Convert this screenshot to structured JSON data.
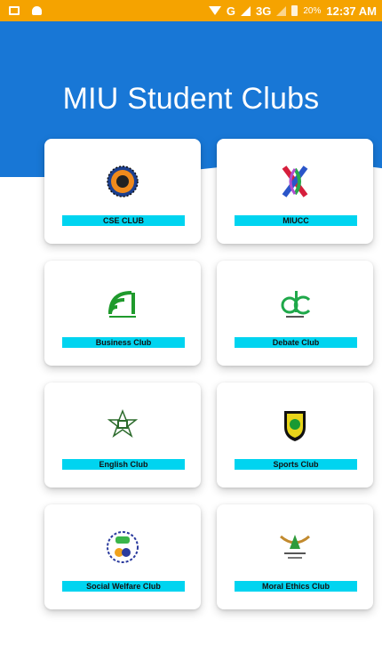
{
  "status_bar": {
    "network": "G",
    "network_3g": "3G",
    "battery_percent": "20%",
    "time": "12:37 AM"
  },
  "header": {
    "title": "MIU Student Clubs",
    "color": "#1877d6"
  },
  "clubs": [
    {
      "name": "CSE CLUB",
      "icon": "cse-club-logo-icon"
    },
    {
      "name": "MIUCC",
      "icon": "miucc-logo-icon"
    },
    {
      "name": "Business Club",
      "icon": "business-club-logo-icon"
    },
    {
      "name": "Debate Club",
      "icon": "debate-club-logo-icon"
    },
    {
      "name": "English Club",
      "icon": "english-club-logo-icon"
    },
    {
      "name": "Sports Club",
      "icon": "sports-club-logo-icon"
    },
    {
      "name": "Social Welfare Club",
      "icon": "social-welfare-club-logo-icon"
    },
    {
      "name": "Moral Ethics Club",
      "icon": "moral-ethics-club-logo-icon"
    }
  ]
}
